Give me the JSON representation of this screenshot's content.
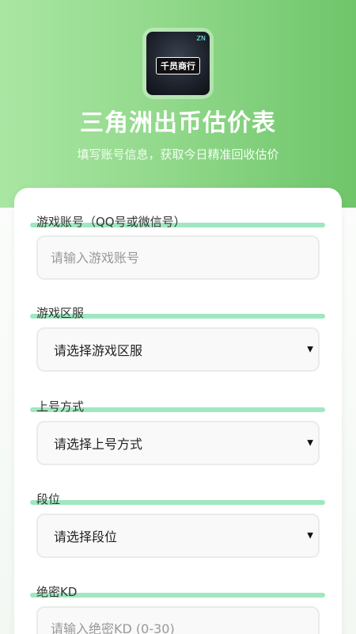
{
  "header": {
    "logo_text": "千员商行",
    "logo_tag": "ZN",
    "title": "三角洲出币估价表",
    "subtitle": "填写账号信息，获取今日精准回收估价"
  },
  "form": {
    "account": {
      "label": "游戏账号（QQ号或微信号）",
      "placeholder": "请输入游戏账号",
      "value": ""
    },
    "server": {
      "label": "游戏区服",
      "selected": "请选择游戏区服"
    },
    "login_method": {
      "label": "上号方式",
      "selected": "请选择上号方式"
    },
    "rank": {
      "label": "段位",
      "selected": "请选择段位"
    },
    "kd": {
      "label": "绝密KD",
      "placeholder": "请输入绝密KD (0-30)",
      "value": ""
    }
  },
  "icons": {
    "caret": "caret-down-icon"
  },
  "colors": {
    "header_start": "#a9e6a3",
    "header_end": "#6fc56a",
    "label_bar": "#9fe7c0"
  }
}
